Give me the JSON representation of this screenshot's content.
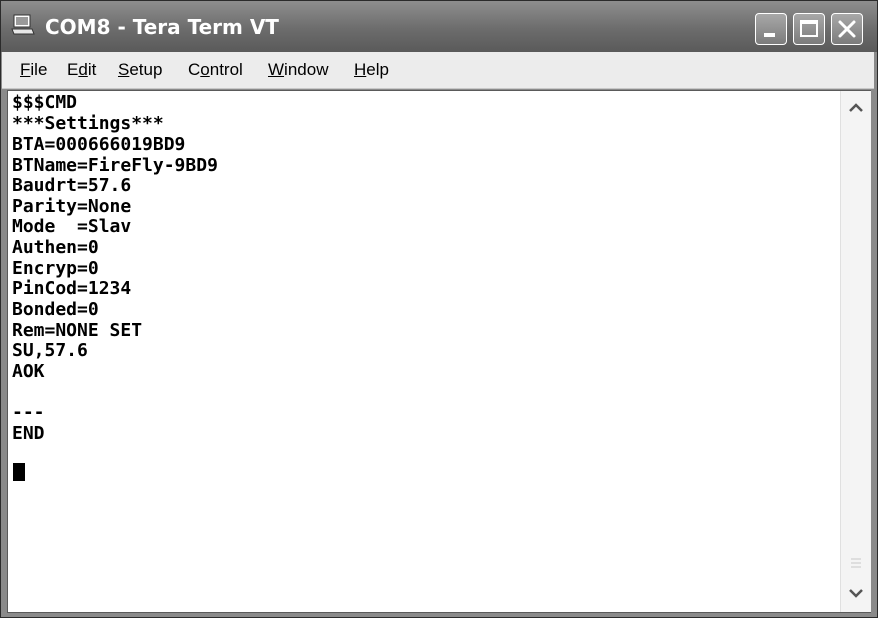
{
  "window": {
    "title": "COM8 - Tera Term VT",
    "icon": "terminal-app-icon"
  },
  "titlebar_buttons": [
    "minimize-icon",
    "maximize-icon",
    "close-icon"
  ],
  "menu": {
    "file": {
      "mnemonic": "F",
      "rest": "ile"
    },
    "edit": {
      "pre": "E",
      "mnemonic": "d",
      "rest": "it"
    },
    "setup": {
      "mnemonic": "S",
      "rest": "etup"
    },
    "control": {
      "pre": "C",
      "mnemonic": "o",
      "rest": "ntrol"
    },
    "window": {
      "mnemonic": "W",
      "rest": "indow"
    },
    "help": {
      "mnemonic": "H",
      "rest": "elp"
    }
  },
  "terminal": {
    "lines": [
      "$$$CMD",
      "***Settings***",
      "BTA=000666019BD9",
      "BTName=FireFly-9BD9",
      "Baudrt=57.6",
      "Parity=None",
      "Mode  =Slav",
      "Authen=0",
      "Encryp=0",
      "PinCod=1234",
      "Bonded=0",
      "Rem=NONE SET",
      "SU,57.6",
      "AOK",
      "",
      "---",
      "END"
    ]
  },
  "scrollbar": {
    "up_icon": "chevron-up-icon",
    "down_icon": "chevron-down-icon",
    "grip_icon": "grip-icon"
  }
}
